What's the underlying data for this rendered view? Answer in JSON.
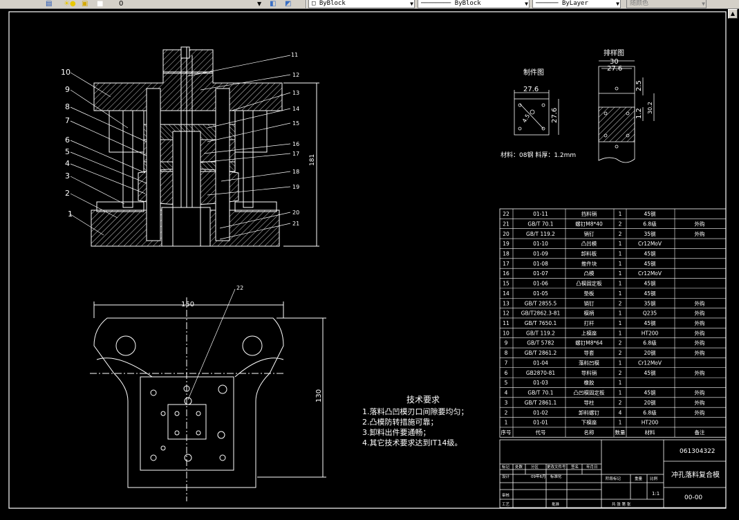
{
  "toolbar": {
    "layer_value": "0",
    "color_value": "ByBlock",
    "linetype_value": "ByBlock",
    "lineweight_value": "ByLayer",
    "plotstyle_value": "随颜色"
  },
  "drawing": {
    "main_labels_left": [
      "10",
      "9",
      "8",
      "7",
      "6",
      "5",
      "4",
      "3",
      "2",
      "1"
    ],
    "main_labels_right": [
      "11",
      "12",
      "13",
      "14",
      "15",
      "16",
      "17",
      "18",
      "19",
      "20",
      "21"
    ],
    "height_dim": "181",
    "plan_width_dim": "150",
    "plan_height_dim": "130",
    "plan_label": "22",
    "part_title": "制件图",
    "part_dim_w": "27.6",
    "part_dim_h": "27.6",
    "part_dim_d": "4.5",
    "layout_title": "排样图",
    "layout_dim_w1": "30",
    "layout_dim_w2": "27.6",
    "layout_dim_s": "2.5",
    "layout_dim_p": "30.2",
    "layout_dim_g": "1.2",
    "material_note": "材料：08钢  料厚：1.2mm",
    "tech_title": "技术要求",
    "tech_items": [
      "1.落料凸凹模刃口间隙要均匀；",
      "2.凸模防转措施可靠；",
      "3.卸料出件要通畅；",
      "4.其它技术要求达到IT14级。"
    ]
  },
  "bom": {
    "headers": [
      "序号",
      "代号",
      "名称",
      "数量",
      "材料",
      "备注"
    ],
    "rows": [
      [
        "22",
        "01-11",
        "挡料销",
        "1",
        "45钢",
        ""
      ],
      [
        "21",
        "GB/T 70.1",
        "螺钉M8*40",
        "2",
        "6.8级",
        "外购"
      ],
      [
        "20",
        "GB/T 119.2",
        "销钉",
        "2",
        "35钢",
        "外购"
      ],
      [
        "19",
        "01-10",
        "凸凹模",
        "1",
        "Cr12MoV",
        ""
      ],
      [
        "18",
        "01-09",
        "卸料板",
        "1",
        "45钢",
        ""
      ],
      [
        "17",
        "01-08",
        "推件块",
        "1",
        "45钢",
        ""
      ],
      [
        "16",
        "01-07",
        "凸模",
        "1",
        "Cr12MoV",
        ""
      ],
      [
        "15",
        "01-06",
        "凸模固定板",
        "1",
        "45钢",
        ""
      ],
      [
        "14",
        "01-05",
        "垫板",
        "1",
        "45钢",
        ""
      ],
      [
        "13",
        "GB/T 2855.5",
        "销钉",
        "2",
        "35钢",
        "外购"
      ],
      [
        "12",
        "GB/T2862.3-81",
        "模柄",
        "1",
        "Q235",
        "外购"
      ],
      [
        "11",
        "GB/T 7650.1",
        "打杆",
        "1",
        "45钢",
        "外购"
      ],
      [
        "10",
        "GB/T 119.2",
        "上模座",
        "1",
        "HT200",
        "外购"
      ],
      [
        "9",
        "GB/T 5782",
        "螺钉M8*64",
        "2",
        "6.8级",
        "外购"
      ],
      [
        "8",
        "GB/T 2861.2",
        "导套",
        "2",
        "20钢",
        "外购"
      ],
      [
        "7",
        "01-04",
        "落料凹模",
        "1",
        "Cr12MoV",
        ""
      ],
      [
        "6",
        "GB2870-81",
        "导料销",
        "2",
        "45钢",
        "外购"
      ],
      [
        "5",
        "01-03",
        "橡胶",
        "1",
        "",
        ""
      ],
      [
        "4",
        "GB/T 70.1",
        "凸凹模固定板",
        "1",
        "45钢",
        "外购"
      ],
      [
        "3",
        "GB/T 2861.1",
        "导柱",
        "2",
        "20钢",
        "外购"
      ],
      [
        "2",
        "01-02",
        "卸料螺钉",
        "4",
        "6.8级",
        "外购"
      ],
      [
        "1",
        "01-01",
        "下模座",
        "1",
        "HT200",
        ""
      ]
    ]
  },
  "title_block": {
    "drawing_no": "061304322",
    "title": "冲孔落料复合模",
    "scale": "1:1",
    "code": "00-00",
    "rev_labels": [
      "标记",
      "处数",
      "分区",
      "更改文件号",
      "签名",
      "年月日"
    ],
    "design_label": "设计",
    "design_date": "09年6月",
    "std_label": "标准化",
    "stage_label": "阶段标记",
    "weight_label": "重量",
    "scale_label": "比例",
    "check_label": "审核",
    "process_label": "工艺",
    "approve_label": "批准",
    "sheet_label": "共  张  第  张"
  }
}
